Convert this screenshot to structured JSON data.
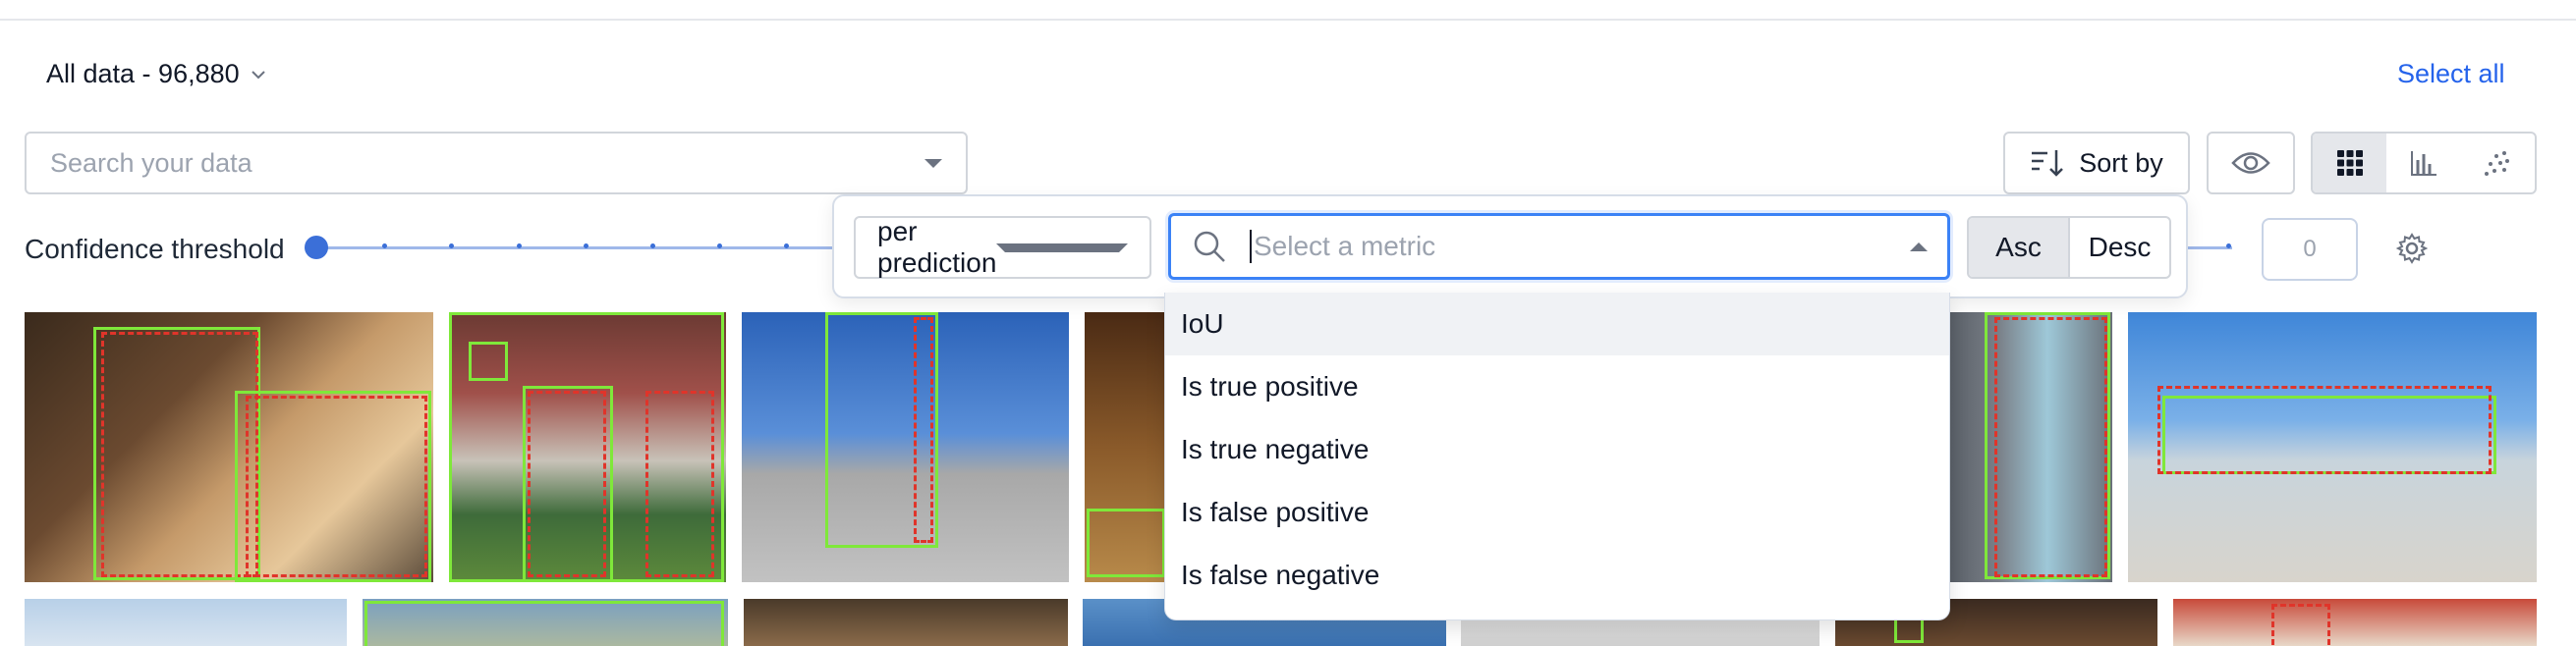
{
  "header": {
    "dataset_label": "All data - 96,880",
    "select_all": "Select all"
  },
  "toolbar": {
    "search_placeholder": "Search your data",
    "sort_label": "Sort by",
    "view_modes": [
      "grid-icon",
      "bar-chart-icon",
      "scatter-icon"
    ],
    "active_view": "grid"
  },
  "confidence": {
    "label": "Confidence threshold",
    "value": "0"
  },
  "sort_popover": {
    "scope": "per prediction",
    "metric_placeholder": "Select a metric",
    "order_options": [
      "Asc",
      "Desc"
    ],
    "active_order": "Asc",
    "metrics": [
      "IoU",
      "Is true positive",
      "Is true negative",
      "Is false positive",
      "Is false negative"
    ],
    "highlighted_metric": "IoU"
  },
  "colors": {
    "accent": "#2563eb",
    "ground_truth_box": "#7fe83a",
    "prediction_box": "#e0342a",
    "slider": "#3b6fd8"
  }
}
